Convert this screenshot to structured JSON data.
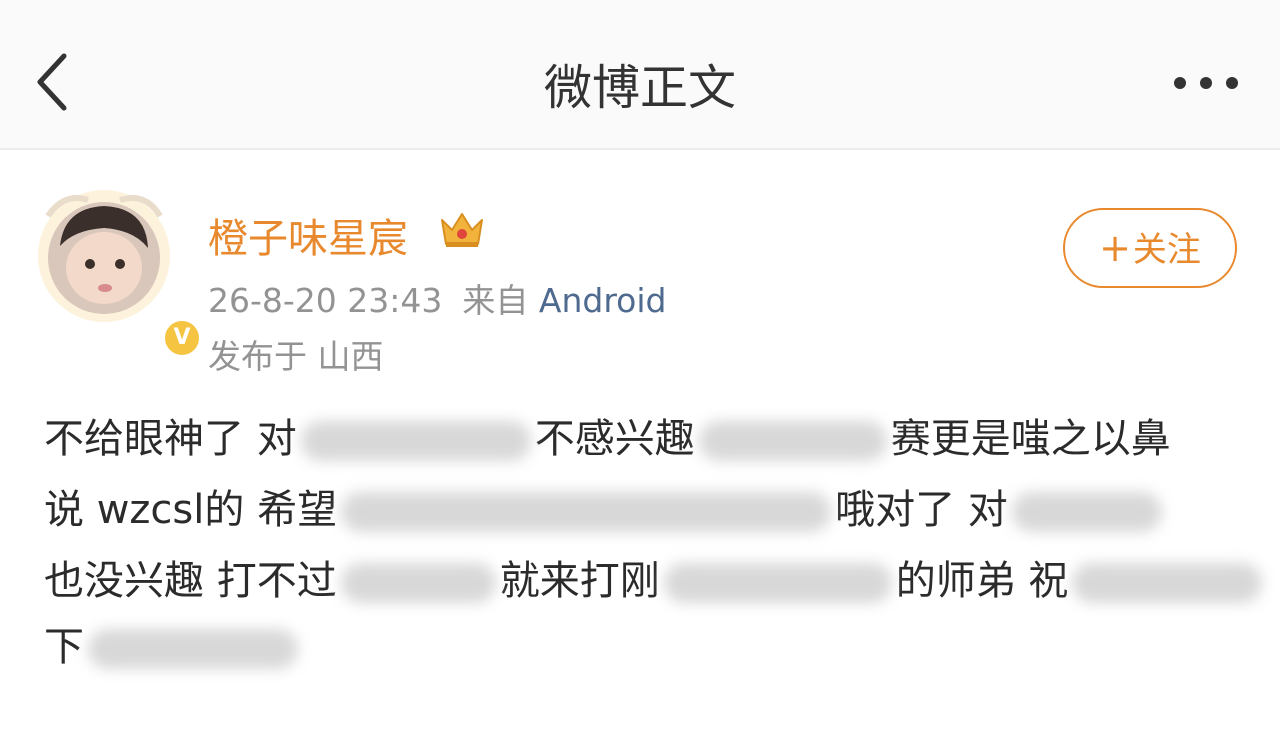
{
  "header": {
    "title": "微博正文",
    "back_icon": "chevron-left-icon",
    "more_icon": "more-dots-icon"
  },
  "post": {
    "author": {
      "name": "橙子味星宸",
      "vip_badge_icon": "crown-icon",
      "verified_icon": "verified-v-icon",
      "verified_label": "V"
    },
    "timestamp": "26-8-20 23:43",
    "source_prefix": "来自",
    "source_app": "Android",
    "location": "发布于 山西",
    "follow_button": {
      "plus": "+",
      "label": "关注"
    },
    "content_lines": [
      [
        "不给眼神了 对",
        "不感兴趣",
        "赛更是嗤之以鼻"
      ],
      [
        "说 wzcsl的 希望",
        "哦对了 对",
        ""
      ],
      [
        "也没兴趣 打不过",
        "就来打刚",
        "的师弟 祝"
      ],
      [
        "下",
        "",
        ""
      ]
    ]
  },
  "colors": {
    "accent_orange": "#e8892e",
    "meta_gray": "#939393",
    "link_blue": "#4f6a8f",
    "nav_bg": "#fafafa"
  }
}
